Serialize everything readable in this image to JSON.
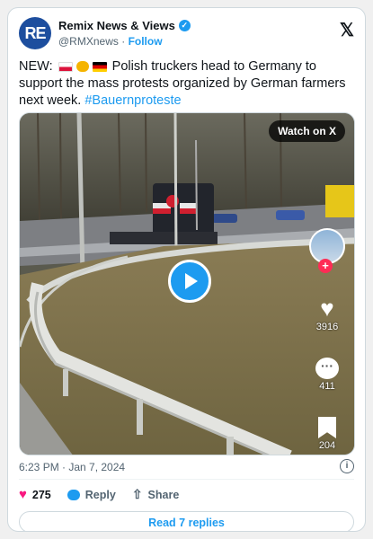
{
  "account": {
    "name": "Remix News & Views",
    "handle": "@RMXnews",
    "separator": "·",
    "follow_label": "Follow",
    "avatar_text": "RE",
    "verified": true
  },
  "tweet": {
    "prefix": "NEW:",
    "body": "Polish truckers head to Germany to support the mass protests organized by German farmers next week.",
    "hashtag": "#Bauernproteste",
    "emoji_icons": [
      "flag-poland-icon",
      "handshake-icon",
      "flag-germany-icon"
    ]
  },
  "media": {
    "watch_label": "Watch on X",
    "tiktok_likes": "3916",
    "tiktok_comments": "411",
    "tiktok_saves": "204"
  },
  "meta": {
    "timestamp": "6:23 PM · Jan 7, 2024"
  },
  "actions": {
    "likes": "275",
    "reply_label": "Reply",
    "share_label": "Share",
    "read_replies_label": "Read 7 replies"
  },
  "colors": {
    "accent": "#1d9bf0",
    "like": "#f91880",
    "tiktok_plus": "#fe2c55"
  }
}
